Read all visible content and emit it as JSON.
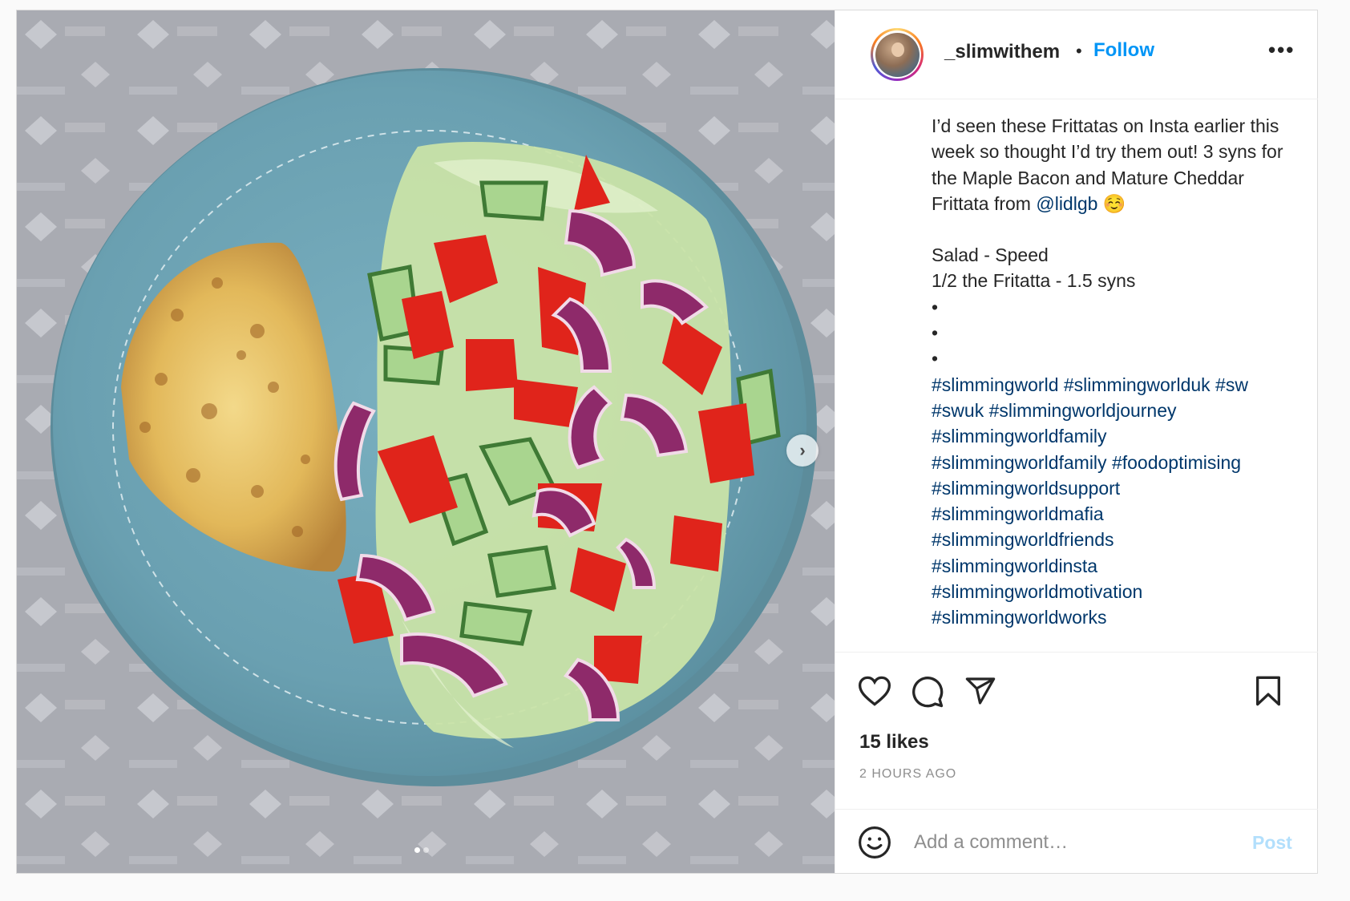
{
  "post": {
    "username": "_slimwithem",
    "separator": "•",
    "follow_label": "Follow",
    "more_label": "•••",
    "caption": {
      "line1": "I’d seen these Frittatas on Insta earlier this week so thought I’d try them out! 3 syns for the Maple Bacon and Mature Cheddar Frittata from ",
      "mention": "@lidlgb",
      "emoji": "☺️",
      "line2": "Salad - Speed",
      "line3": "1/2 the Fritatta - 1.5 syns",
      "dot1": "•",
      "dot2": "•",
      "dot3": "•",
      "hashtags": [
        "#slimmingworld",
        "#slimmingworlduk",
        "#sw",
        "#swuk",
        "#slimmingworldjourney",
        "#slimmingworldfamily",
        "#slimmingworldfamily",
        "#foodoptimising",
        "#slimmingworldsupport",
        "#slimmingworldmafia",
        "#slimmingworldfriends",
        "#slimmingworldinsta",
        "#slimmingworldmotivation",
        "#slimmingworldworks"
      ]
    },
    "likes": "15 likes",
    "time": "2 HOURS AGO",
    "comment_placeholder": "Add a comment…",
    "post_label": "Post",
    "next_label": "›",
    "carousel_index": 1,
    "carousel_count": 2
  },
  "colors": {
    "accent": "#0095f6",
    "link": "#00376b",
    "post_disabled": "#b2dffc",
    "plate": "#6fa6b6"
  },
  "icons": [
    "heart-icon",
    "comment-icon",
    "share-icon",
    "bookmark-icon",
    "emoji-icon",
    "chevron-right-icon"
  ]
}
